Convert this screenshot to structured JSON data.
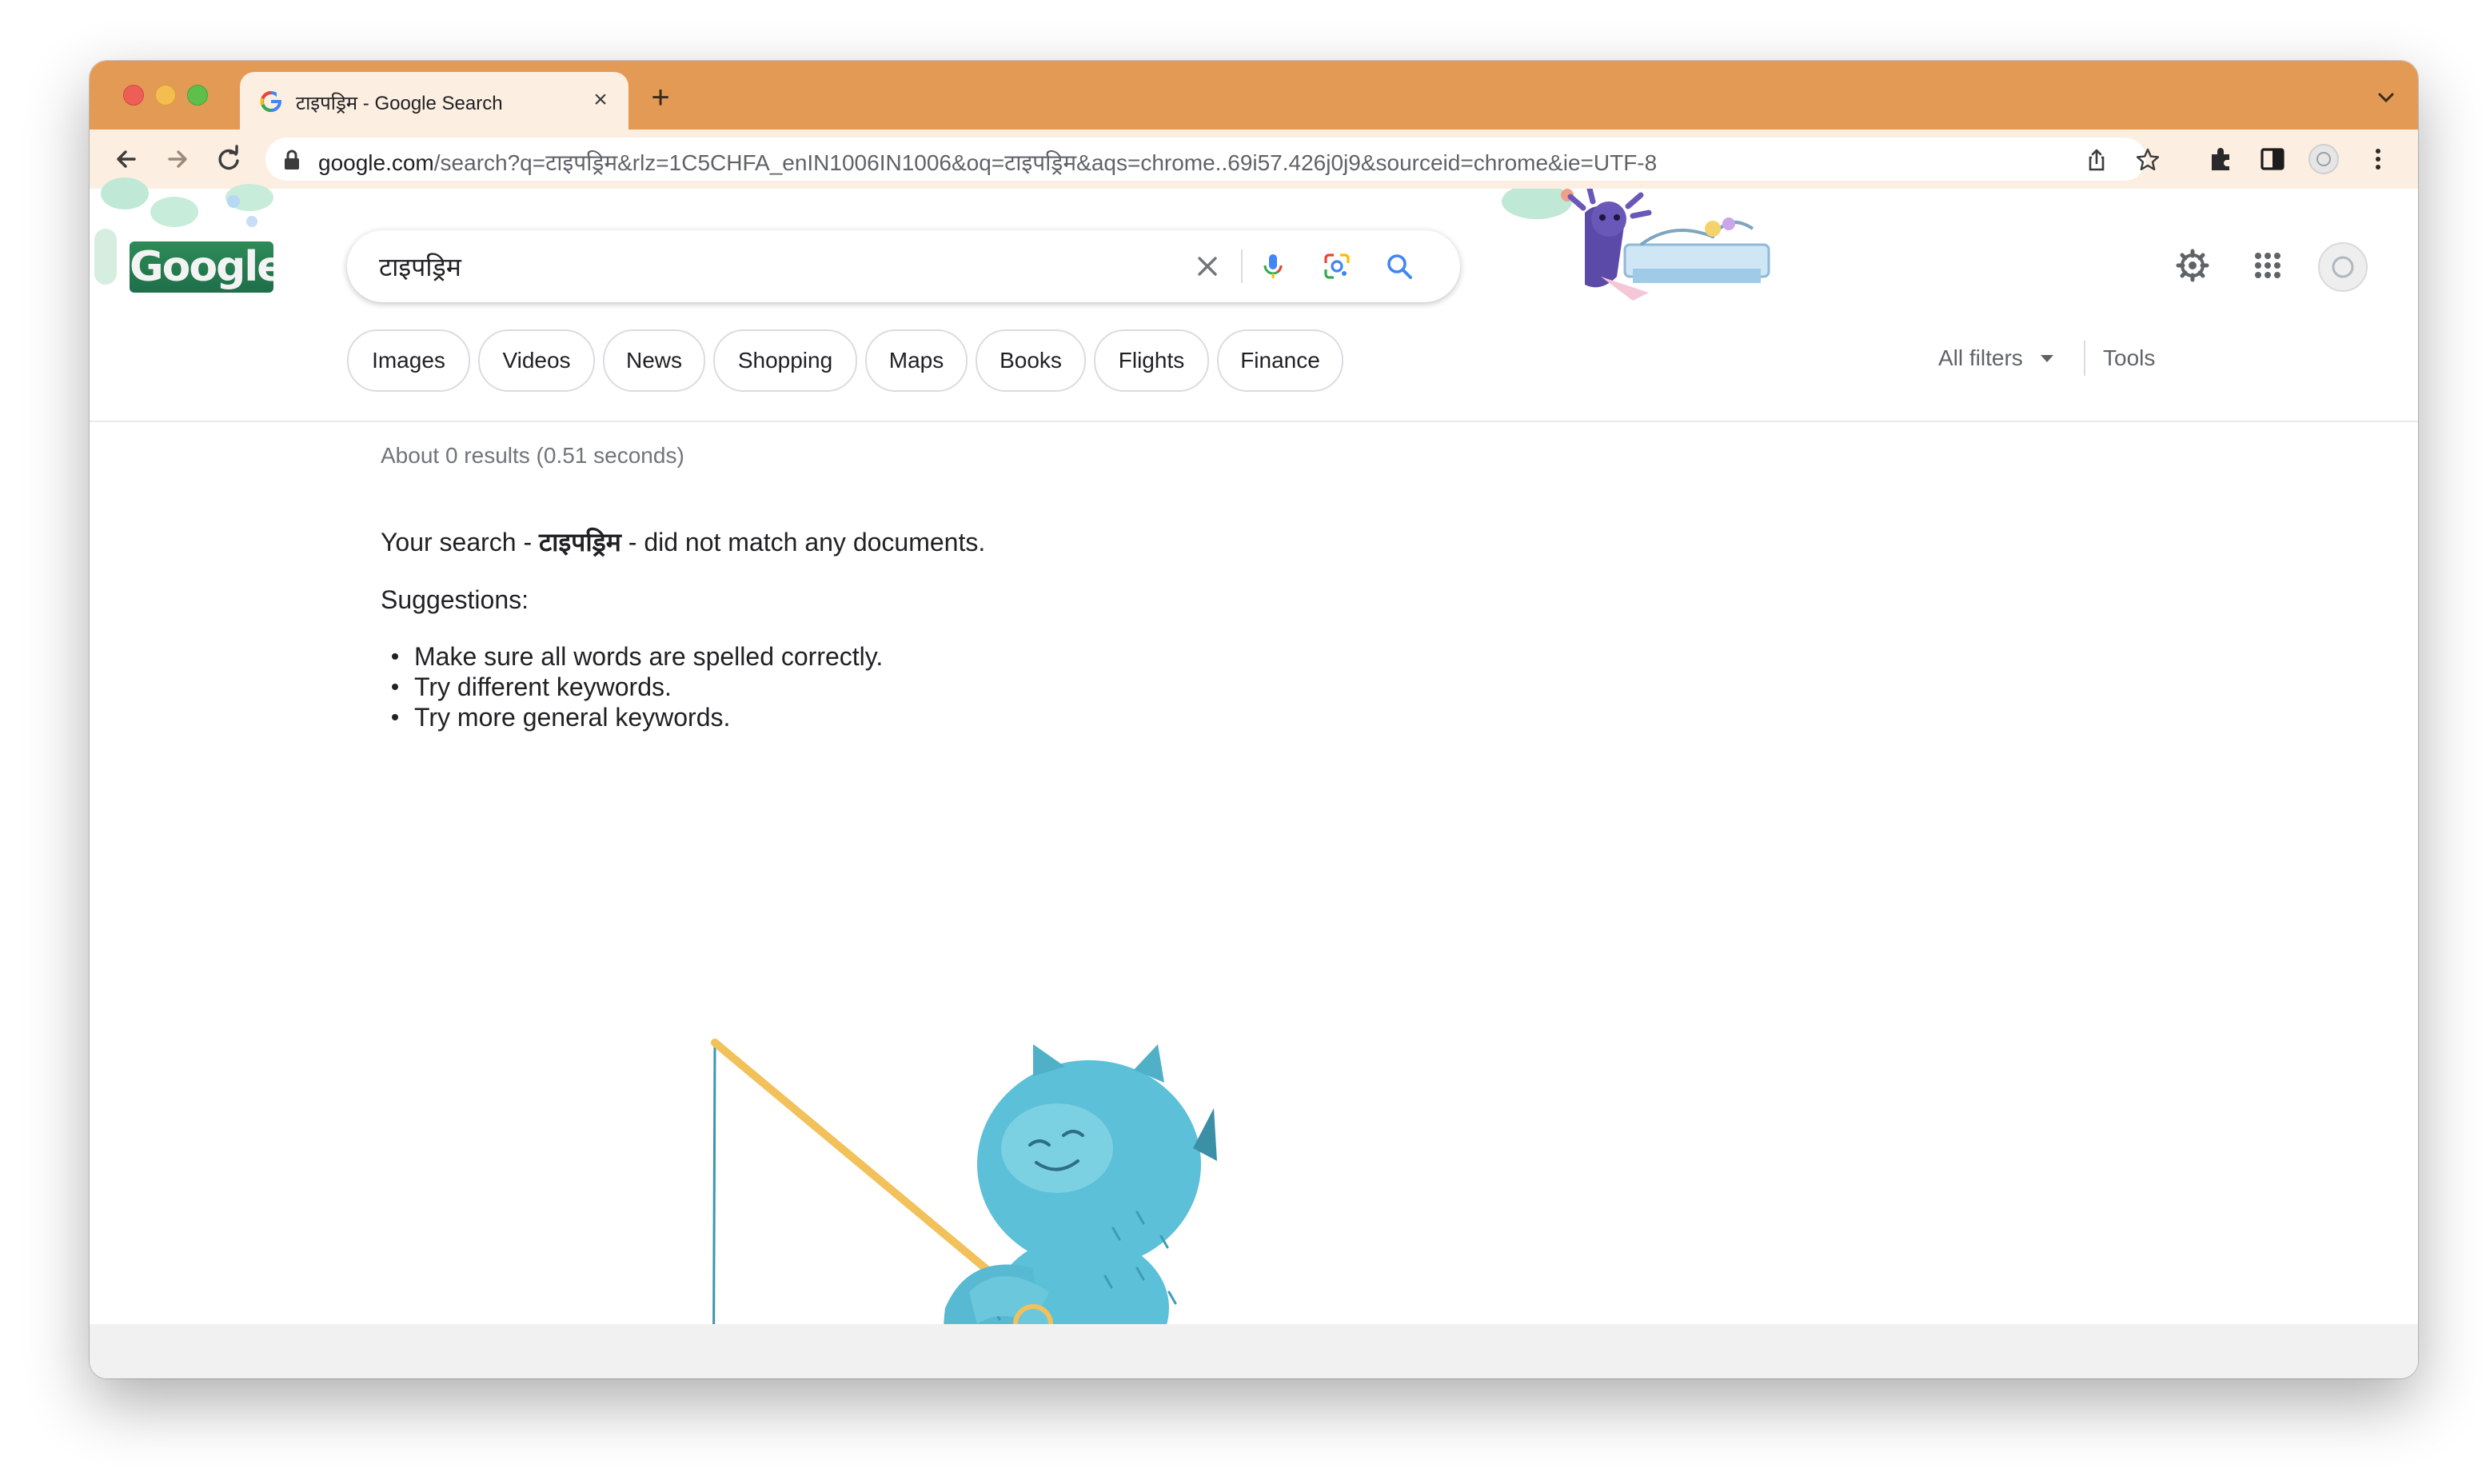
{
  "browser": {
    "tab_title": "टाइपड्रिम - Google Search",
    "url_host": "google.com",
    "url_rest": "/search?q=टाइपड्रिम&rlz=1C5CHFA_enIN1006IN1006&oq=टाइपड्रिम&aqs=chrome..69i57.426j0j9&sourceid=chrome&ie=UTF-8",
    "new_tab_label": "+",
    "close_label": "×"
  },
  "search": {
    "logo_text": "Google",
    "query": "टाइपड्रिम"
  },
  "chips": [
    "Images",
    "Videos",
    "News",
    "Shopping",
    "Maps",
    "Books",
    "Flights",
    "Finance"
  ],
  "filters": {
    "all_filters": "All filters",
    "tools": "Tools"
  },
  "results": {
    "stats": "About 0 results (0.51 seconds)",
    "prefix": "Your search - ",
    "term": "टाइपड्रिम",
    "suffix": " - did not match any documents.",
    "suggestions_title": "Suggestions:",
    "suggestions": [
      "Make sure all words are spelled correctly.",
      "Try different keywords.",
      "Try more general keywords."
    ]
  },
  "colors": {
    "titlebar": "#e39a55",
    "toolbar": "#fceee0",
    "google_blue": "#4285f4",
    "monster": "#5bc0d8"
  },
  "icons": [
    "back-icon",
    "forward-icon",
    "reload-icon",
    "lock-icon",
    "share-icon",
    "star-icon",
    "extensions-icon",
    "sidebar-icon",
    "profile-icon",
    "kebab-menu-icon",
    "clear-icon",
    "mic-icon",
    "lens-icon",
    "search-icon",
    "settings-icon",
    "apps-grid-icon",
    "account-avatar-icon"
  ]
}
